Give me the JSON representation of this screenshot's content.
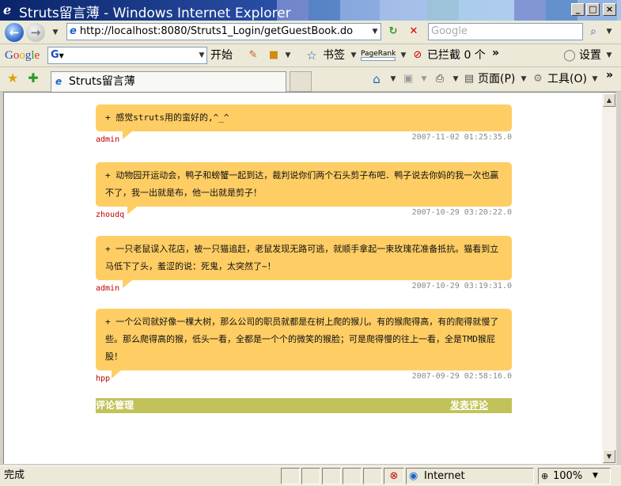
{
  "window": {
    "title": "Struts留言薄 - Windows Internet Explorer"
  },
  "address": {
    "url": "http://localhost:8080/Struts1_Login/getGuestBook.do",
    "search_placeholder": "Google"
  },
  "googlebar": {
    "logo": "Google",
    "start_label": "开始",
    "bookmarks_label": "书签",
    "pagerank_label": "PageRank",
    "blocked_label": "已拦截 0 个",
    "more": "»",
    "settings_label": "设置"
  },
  "tabs": [
    {
      "label": "Struts留言薄"
    }
  ],
  "commandbar": {
    "page_label": "页面(P)",
    "tools_label": "工具(O)",
    "more": "»"
  },
  "messages": [
    {
      "text": "+ 感觉struts用的蛮好的,^_^",
      "author": "admin",
      "date": "2007-11-02 01:25:35.0"
    },
    {
      "text": "+ 动物园开运动会，鸭子和螃蟹一起到达，裁判说你们两个石头剪子布吧．鸭子说去你妈的我一次也赢不了，我一出就是布，他一出就是剪子！",
      "author": "zhoudq",
      "date": "2007-10-29 03:20:22.0"
    },
    {
      "text": "+ 一只老鼠误入花店，被一只猫追赶，老鼠发现无路可逃，就顺手拿起一束玫瑰花准备抵抗。猫看到立马低下了头，羞涩的说：死鬼，太突然了~！",
      "author": "admin",
      "date": "2007-10-29 03:19:31.0"
    },
    {
      "text": "+ 一个公司就好像一棵大树，那么公司的职员就都是在树上爬的猴儿。有的猴爬得高，有的爬得就慢了些。那么爬得高的猴，低头一看，全都是一个个的微笑的猴脸；可是爬得慢的往上一看，全是TMD猴屁股！",
      "author": "hpp",
      "date": "2007-09-29 02:58:16.0"
    }
  ],
  "footer": {
    "left_label": "评论管理",
    "right_label": "发表评论"
  },
  "status": {
    "text": "完成",
    "zone": "Internet",
    "zoom": "100%"
  }
}
